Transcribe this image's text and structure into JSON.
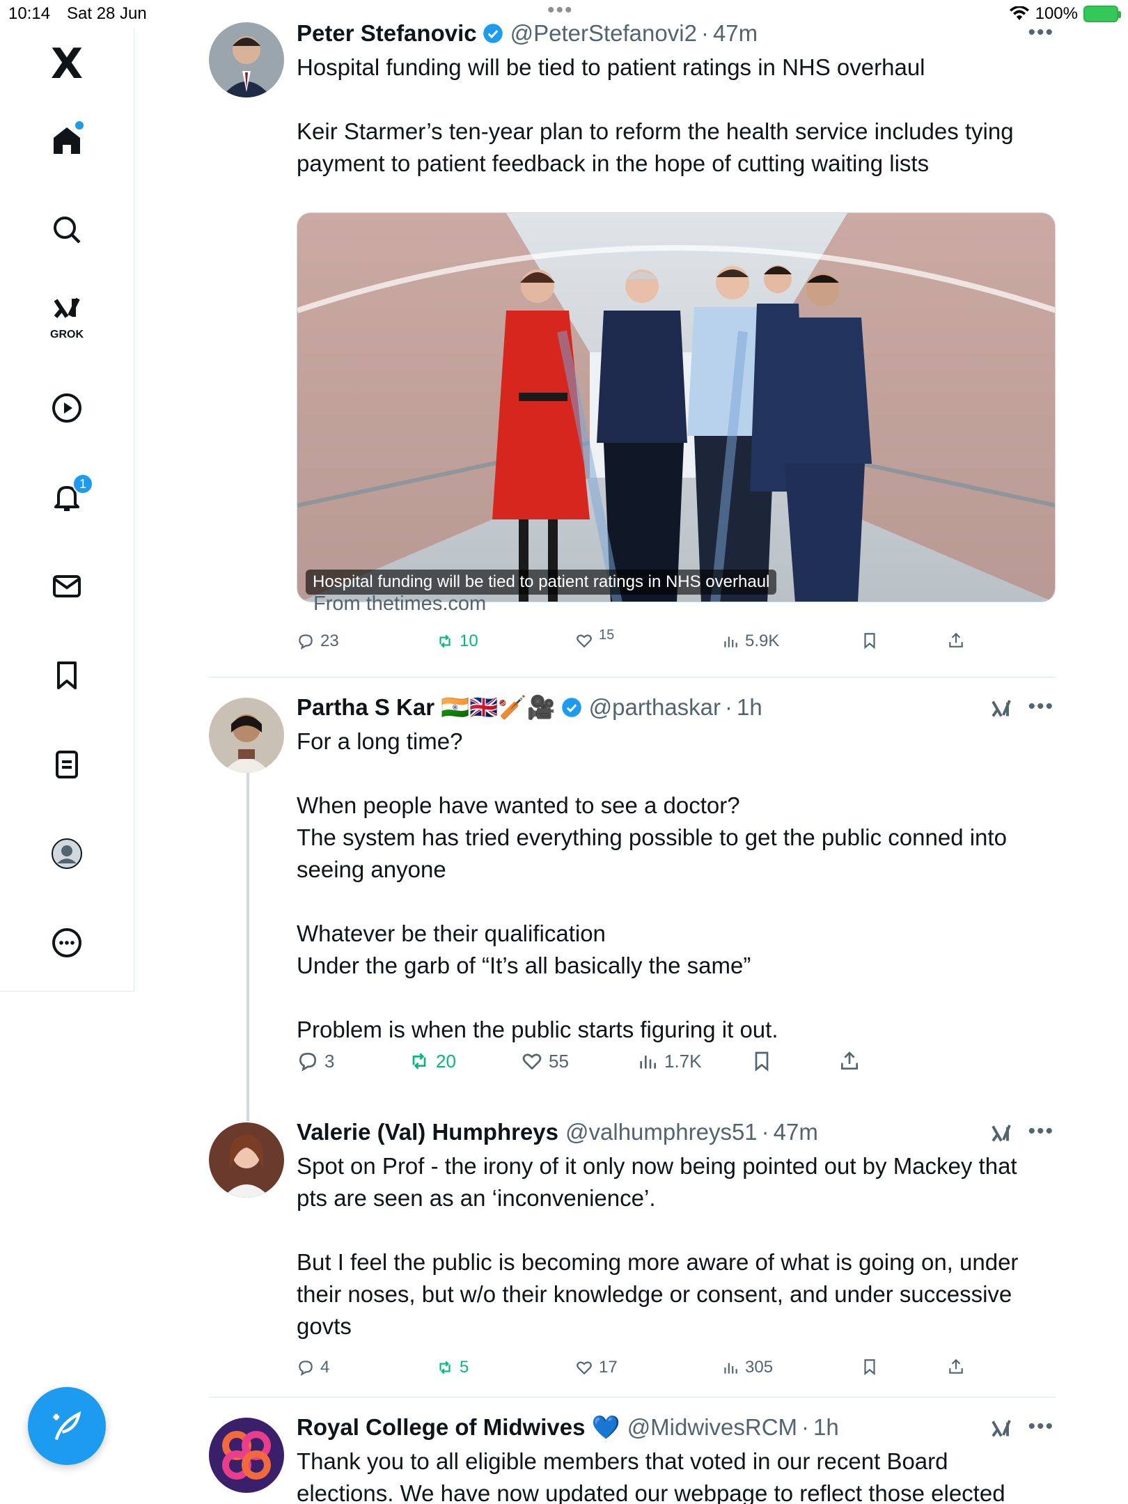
{
  "status_bar": {
    "time": "10:14",
    "date": "Sat 28 Jun",
    "battery": "100%"
  },
  "sidebar": {
    "logo": "X",
    "grok_label": "GROK",
    "notifications_badge": "1"
  },
  "tweets": [
    {
      "name": "Peter Stefanovic",
      "handle": "@PeterStefanovi2",
      "time": "47m",
      "text": "Hospital funding will be tied to patient ratings in NHS overhaul\n\nKeir Starmer’s ten-year plan to reform the health service includes tying payment to patient feedback in the hope of cutting waiting lists",
      "card_caption": "Hospital funding will be tied to patient ratings in NHS overhaul",
      "card_source": "From thetimes.com",
      "replies": "23",
      "retweets": "10",
      "likes": "15",
      "views": "5.9K"
    },
    {
      "name": "Partha S Kar 🇮🇳🇬🇧🏏🎥",
      "handle": "@parthaskar",
      "time": "1h",
      "text": "For a long time?\n\nWhen people have wanted to see a doctor?\nThe system has tried everything possible to get the public conned into seeing anyone\n\nWhatever be their qualification\nUnder the garb of “It’s all basically the same”\n\nProblem is when the public starts figuring it out.",
      "replies": "3",
      "retweets": "20",
      "likes": "55",
      "views": "1.7K"
    },
    {
      "name": "Valerie (Val) Humphreys",
      "handle": "@valhumphreys51",
      "time": "47m",
      "text": "Spot on Prof - the irony of it only now being pointed out by Mackey that pts are seen as an ‘inconvenience’.\n\nBut I feel the public is becoming more aware of what is going on, under their noses, but w/o their knowledge or consent, and under successive govts",
      "replies": "4",
      "retweets": "5",
      "likes": "17",
      "views": "305"
    },
    {
      "name": "Royal College of Midwives 💙",
      "handle": "@MidwivesRCM",
      "time": "1h",
      "text": "Thank you to all eligible members that voted in our recent Board elections. We have now updated our webpage to reflect those elected"
    }
  ],
  "colors": {
    "accent": "#1d9bf0",
    "retweet": "#00ba7c",
    "muted": "#536471"
  }
}
